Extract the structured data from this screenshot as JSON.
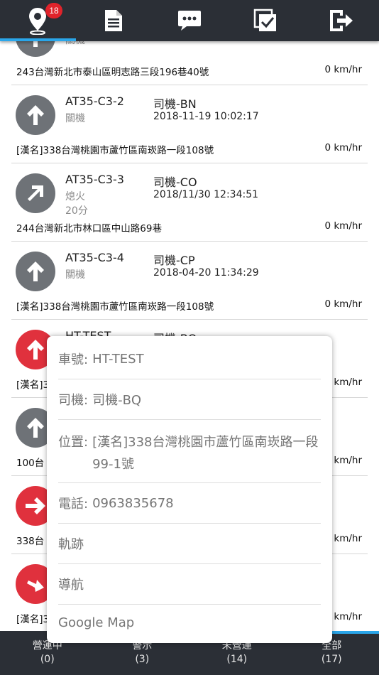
{
  "nav": {
    "badge": "18",
    "tabs": [
      "location-pin-icon",
      "document-icon",
      "chat-icon",
      "checkbox-icon",
      "logout-icon"
    ]
  },
  "list": {
    "rows": [
      {
        "plate": "",
        "status": "關機",
        "status2": "",
        "driver": "",
        "time": "",
        "address": "243台灣新北市泰山區明志路三段196巷40號",
        "speed": "0 km/hr",
        "arrow_color": "gray"
      },
      {
        "plate": "AT35-C3-2",
        "status": "關機",
        "status2": "",
        "driver": "司機-BN",
        "time": "2018-11-19 10:02:17",
        "address": "[漢名]338台灣桃園市蘆竹區南崁路一段108號",
        "speed": "0 km/hr",
        "arrow_color": "gray"
      },
      {
        "plate": "AT35-C3-3",
        "status": "熄火",
        "status2": "20分",
        "driver": "司機-CO",
        "time": "2018/11/30 12:34:51",
        "address": "244台灣新北市林口區中山路69巷",
        "speed": "0 km/hr",
        "arrow_color": "gray"
      },
      {
        "plate": "AT35-C3-4",
        "status": "關機",
        "status2": "",
        "driver": "司機-CP",
        "time": "2018-04-20 11:34:29",
        "address": "[漢名]338台灣桃園市蘆竹區南崁路一段108號",
        "speed": "0 km/hr",
        "arrow_color": "gray"
      },
      {
        "plate": "HT-TEST",
        "status": "",
        "status2": "",
        "driver": "司機-BQ",
        "time": "",
        "address": "[漢名]3",
        "speed": "km/hr",
        "arrow_color": "red"
      },
      {
        "plate": "",
        "status": "",
        "status2": "",
        "driver": "",
        "time": "",
        "address": "100台",
        "speed": "km/hr",
        "arrow_color": "gray"
      },
      {
        "plate": "",
        "status": "",
        "status2": "",
        "driver": "",
        "time": "",
        "address": "338台",
        "speed": "km/hr",
        "arrow_color": "red"
      },
      {
        "plate": "",
        "status": "",
        "status2": "",
        "driver": "",
        "time": "",
        "address": "[漢名]3",
        "speed": "km/hr",
        "arrow_color": "red"
      }
    ]
  },
  "popup": {
    "plate_label": "車號:",
    "plate_value": "HT-TEST",
    "driver_label": "司機:",
    "driver_value": "司機-BQ",
    "location_label": "位置:",
    "location_value": "[漢名]338台灣桃園市蘆竹區南崁路一段99-1號",
    "phone_label": "電話:",
    "phone_value": "0963835678",
    "track": "軌跡",
    "navigate": "導航",
    "google_map": "Google Map"
  },
  "bottom": {
    "tabs": [
      {
        "label": "營運中",
        "count": "(0)"
      },
      {
        "label": "警示",
        "count": "(3)"
      },
      {
        "label": "未營運",
        "count": "(14)"
      },
      {
        "label": "全部",
        "count": "(17)"
      }
    ]
  },
  "colors": {
    "bar": "#2b2f36",
    "accent": "#2aa6ea",
    "badge": "#e0232b",
    "arrow_gray": "#6e7277",
    "arrow_red": "#e0313d"
  }
}
